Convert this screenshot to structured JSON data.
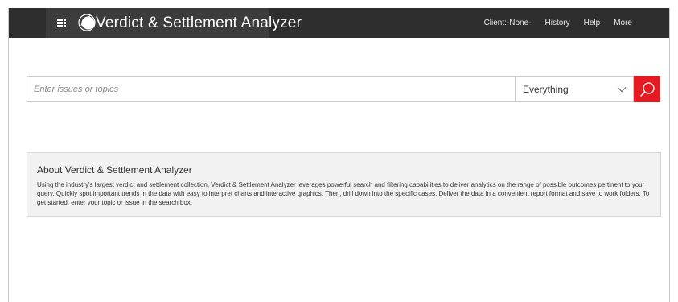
{
  "header": {
    "app_title": "Verdict & Settlement Analyzer",
    "nav": {
      "client": "Client:-None-",
      "history": "History",
      "help": "Help",
      "more": "More"
    }
  },
  "search": {
    "placeholder": "Enter issues or topics",
    "value": "",
    "scope": "Everything"
  },
  "about": {
    "title": "About Verdict & Settlement Analyzer",
    "body": "Using the industry's largest verdict and settlement collection, Verdict & Settlement Analyzer leverages powerful search and filtering capabilities to deliver analytics on the range of possible outcomes pertinent to your query. Quickly spot important trends in the data with easy to interpret charts and interactive graphics. Then, drill down into the specific cases. Deliver the data in a convenient report format and save to work folders. To get started, enter your topic or issue in the search box."
  },
  "colors": {
    "topbar": "#2e2e2e",
    "brand_block": "#3c3c3c",
    "accent": "#e41b23",
    "about_bg": "#f2f2f2"
  },
  "icons": {
    "grid": "grid-icon",
    "logo": "logo-icon",
    "dropdown": "chevron-down-icon",
    "search": "search-icon"
  }
}
